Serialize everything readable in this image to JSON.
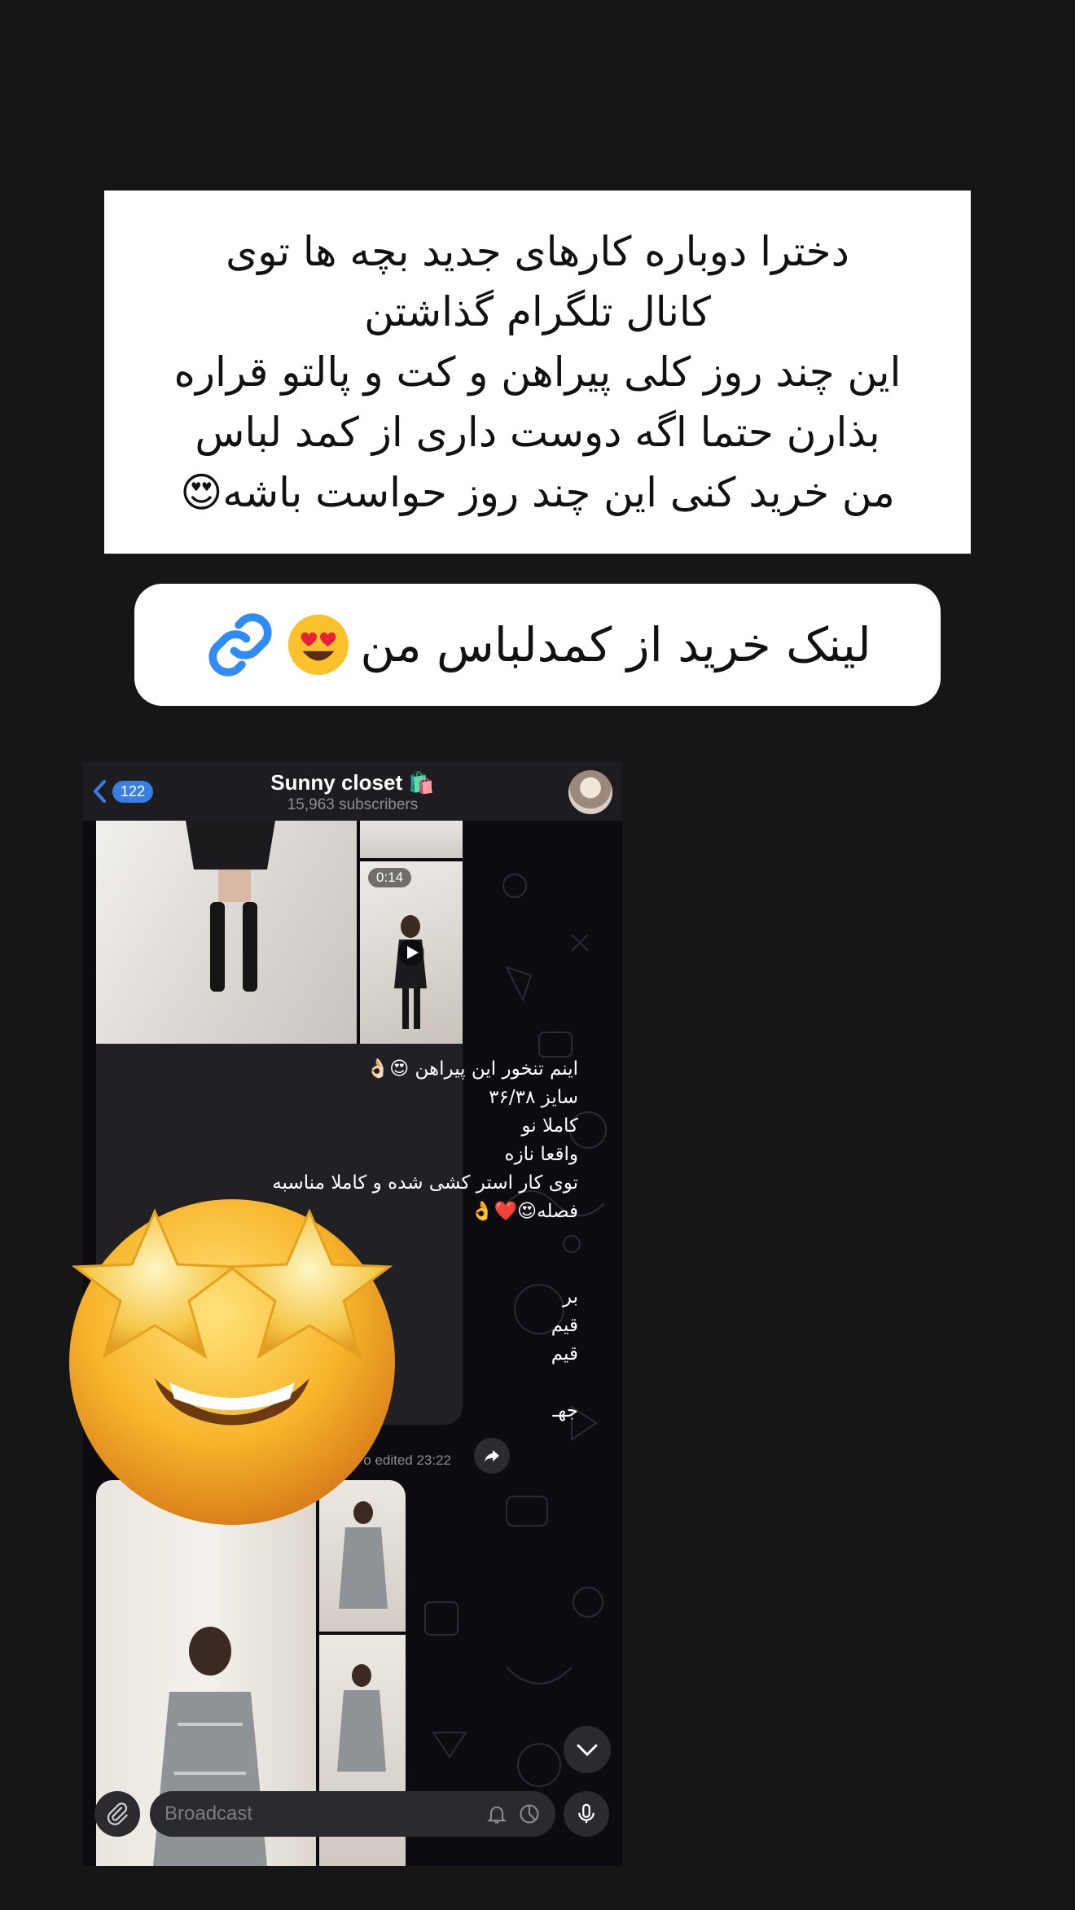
{
  "story": {
    "caption_lines": [
      "دخترا دوباره کارهای جدید بچه ها توی",
      "کانال تلگرام گذاشتن",
      "این چند روز کلی پیراهن و کت و پالتو قراره",
      "بذارن حتما اگه دوست داری از کمد لباس",
      "من خرید کنی این چند روز حواست باشه😍"
    ],
    "link_sticker_text": "لینک خرید از کمدلباس من"
  },
  "telegram": {
    "back_count": "122",
    "channel_title": "Sunny closet 🛍️",
    "subscribers": "15,963 subscribers",
    "video_duration": "0:14",
    "message_lines": [
      "اینم تنخور این پیراهن 😍👌🏻",
      "سایز ۳۶/۳۸",
      "کاملا نو",
      "واقعا نازه",
      "توی کار استر کشی شده و کاملا مناسبه",
      "فصله😍❤️👌",
      "",
      "",
      "بر",
      "قیم",
      "قیم",
      "",
      "جهـ"
    ],
    "message_time": "o edited 23:22",
    "input_placeholder": "Broadcast"
  },
  "colors": {
    "background": "#161616",
    "telegram_accent": "#3a7fe0",
    "link_icon": "#2f8bf5"
  },
  "icons": {
    "link": "link-icon",
    "emoji_heart_eyes": "smiling-face-with-heart-eyes",
    "emoji_star_struck": "star-struck-emoji"
  }
}
